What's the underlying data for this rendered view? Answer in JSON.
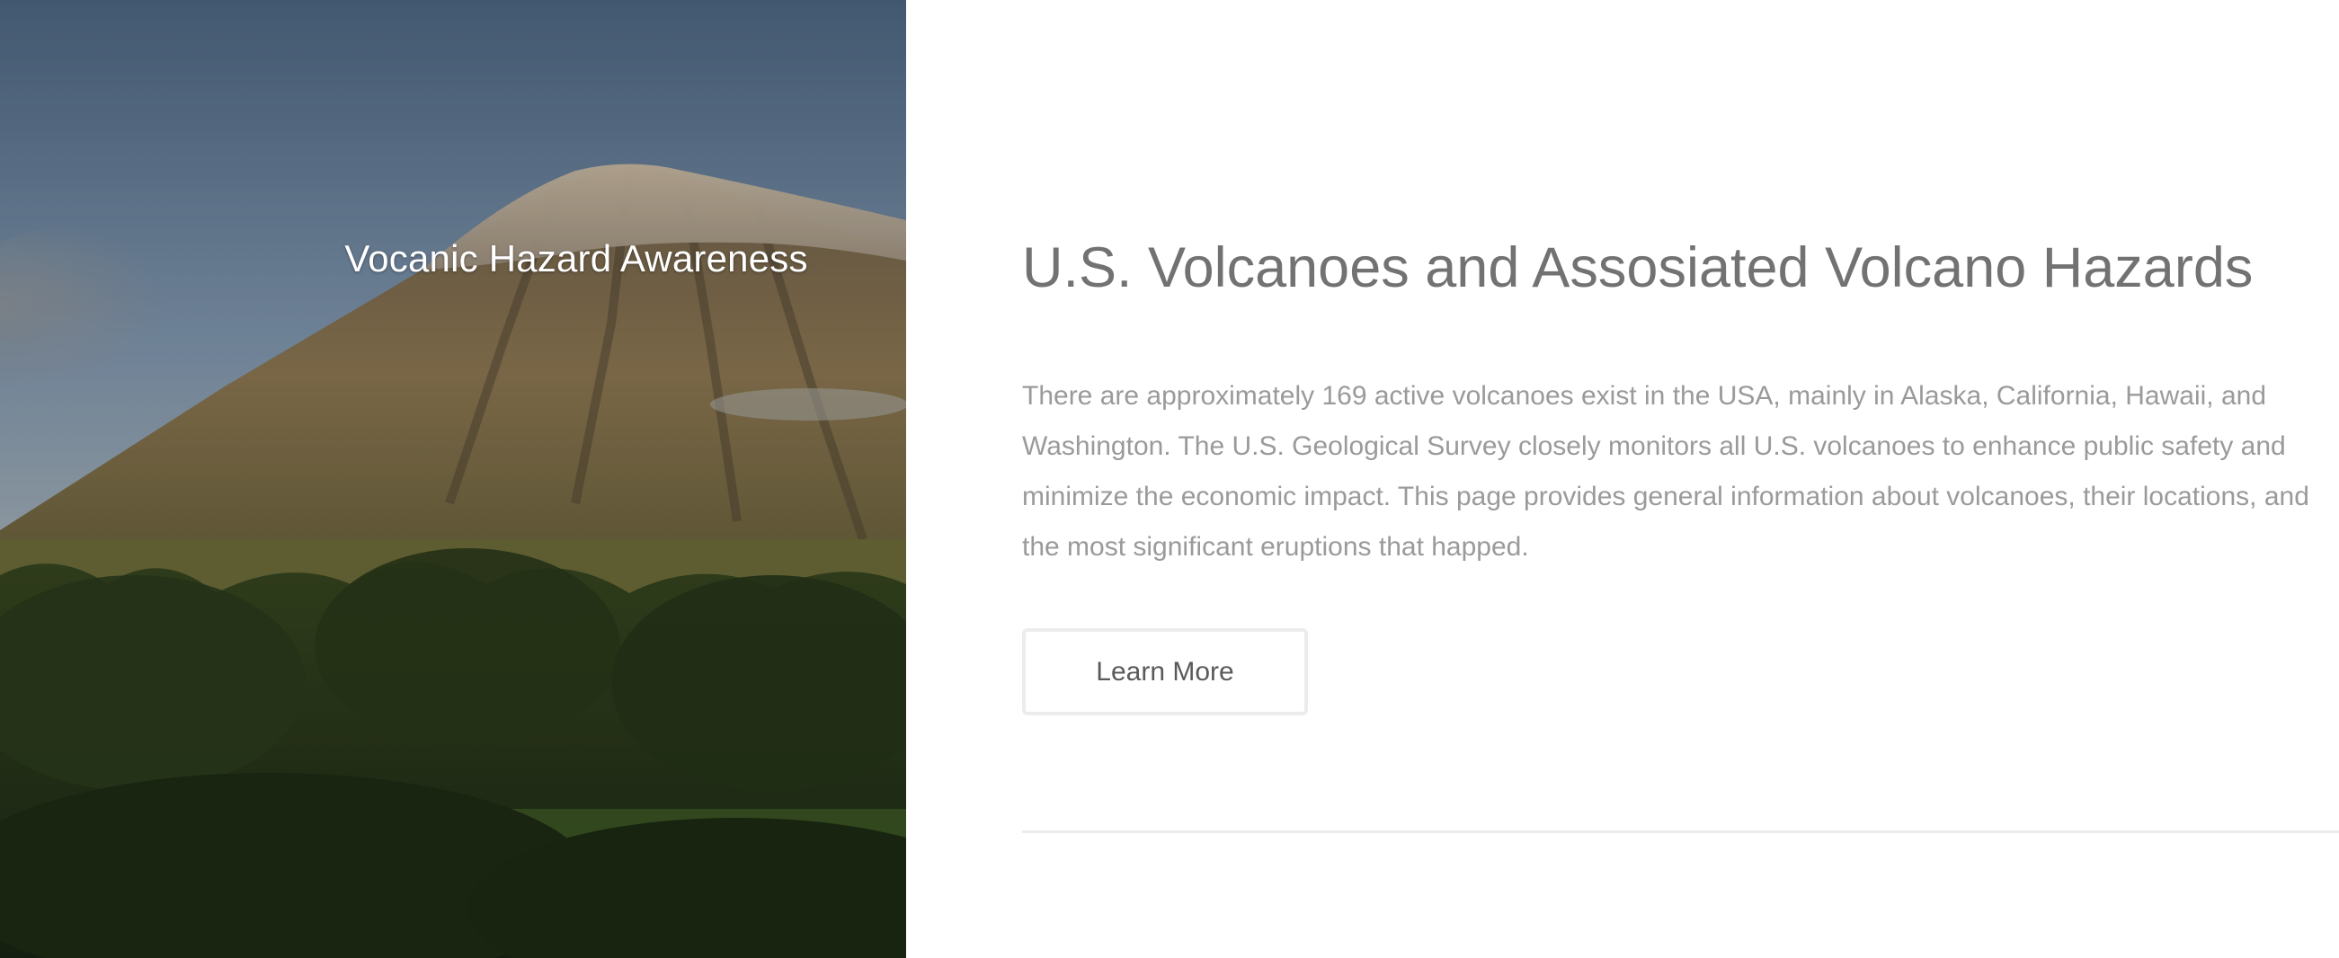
{
  "hero": {
    "title": "Vocanic Hazard Awareness"
  },
  "main": {
    "heading": "U.S. Volcanoes and Assosiated Volcano Hazards",
    "body": "There are approximately 169 active volcanoes exist in the USA, mainly in Alaska, California, Hawaii, and Washington. The U.S. Geological Survey closely monitors all U.S. volcanoes to enhance public safety and minimize the economic impact. This page provides general information about volcanoes, their locations, and the most significant eruptions that happed.",
    "button_label": "Learn More"
  },
  "colors": {
    "heading": "#727272",
    "body": "#9a9a9a",
    "button_border": "#ececec",
    "divider": "#ececec"
  }
}
